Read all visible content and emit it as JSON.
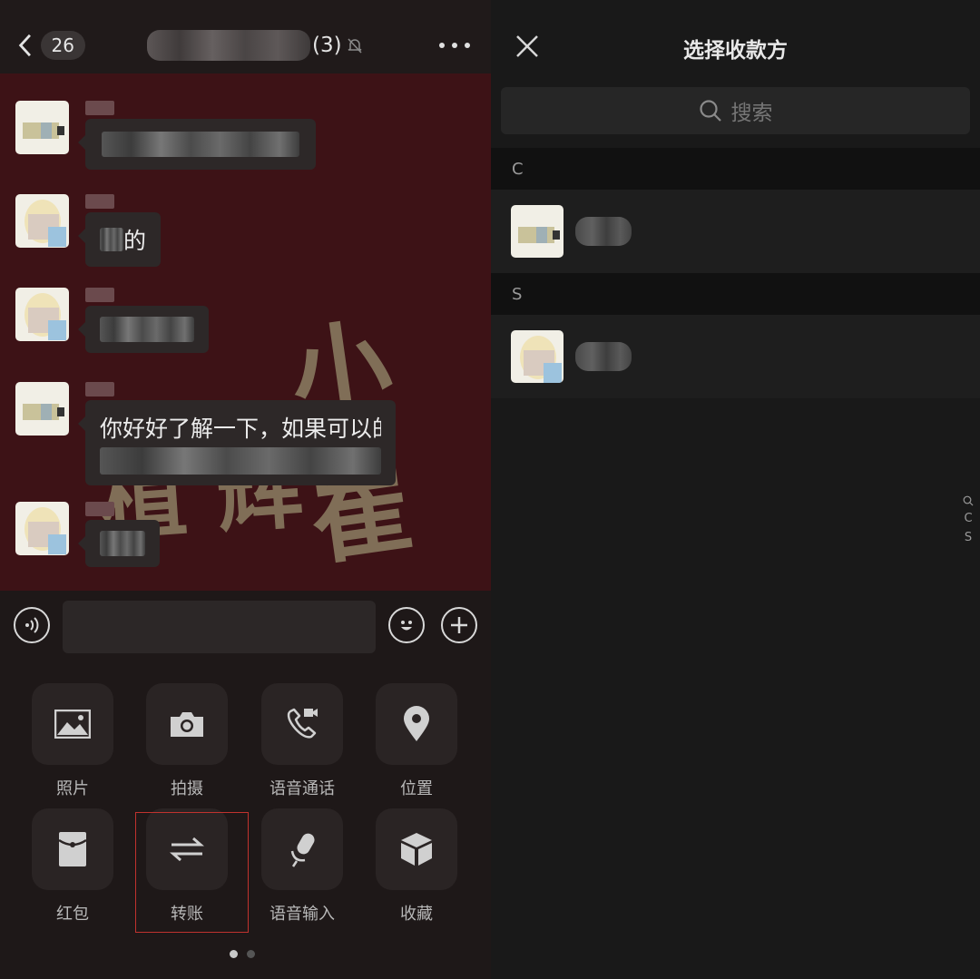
{
  "chat": {
    "back_count": "26",
    "group_count": "(3)",
    "messages": [
      {
        "type": "blurred",
        "avatar": "sticker"
      },
      {
        "type": "partial",
        "visible_text": "的",
        "avatar": "baby"
      },
      {
        "type": "blurred",
        "avatar": "baby"
      },
      {
        "type": "long",
        "visible_text": "你好好了解一下，如果可以的",
        "avatar": "sticker"
      },
      {
        "type": "blurred",
        "avatar": "baby"
      }
    ],
    "watermark": {
      "line1": "小 崔",
      "line2": "植 辉"
    }
  },
  "input_bar": {
    "voice_icon": "voice-icon",
    "emoji_icon": "emoji-icon",
    "plus_icon": "plus-icon"
  },
  "tools": [
    {
      "label": "照片",
      "icon": "photo-icon"
    },
    {
      "label": "拍摄",
      "icon": "camera-icon"
    },
    {
      "label": "语音通话",
      "icon": "video-call-icon"
    },
    {
      "label": "位置",
      "icon": "location-icon"
    },
    {
      "label": "红包",
      "icon": "red-packet-icon"
    },
    {
      "label": "转账",
      "icon": "transfer-icon"
    },
    {
      "label": "语音输入",
      "icon": "microphone-icon"
    },
    {
      "label": "收藏",
      "icon": "favorites-icon"
    }
  ],
  "highlight_color": "#c0322e",
  "right_panel": {
    "title": "选择收款方",
    "search_placeholder": "搜索",
    "sections": [
      {
        "letter": "C",
        "contacts": [
          {
            "avatar": "sticker"
          }
        ]
      },
      {
        "letter": "S",
        "contacts": [
          {
            "avatar": "baby"
          }
        ]
      }
    ],
    "index": [
      "C",
      "S"
    ]
  }
}
